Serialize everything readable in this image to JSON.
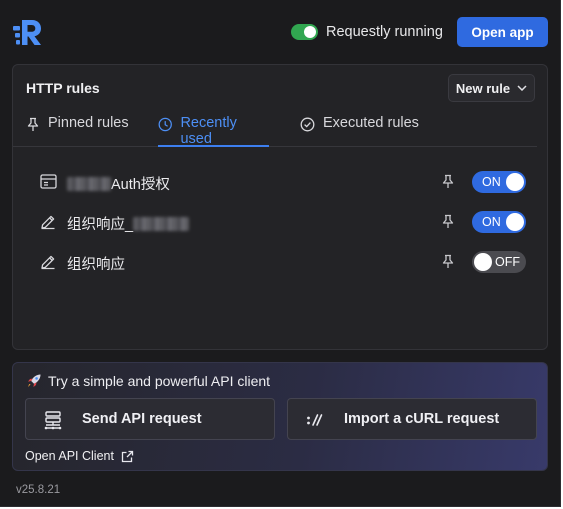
{
  "header": {
    "status_label": "Requestly running",
    "status_on": true,
    "open_app_label": "Open app",
    "accent_color": "#2f6ae0"
  },
  "rules_panel": {
    "title": "HTTP rules",
    "new_rule_label": "New rule",
    "tabs": [
      {
        "label": "Pinned rules",
        "icon": "pin-icon",
        "active": false
      },
      {
        "label": "Recently used",
        "icon": "clock-icon",
        "active": true
      },
      {
        "label": "Executed rules",
        "icon": "check-circle-icon",
        "active": false
      }
    ],
    "rules": [
      {
        "name": "Auth授权",
        "icon": "browser-window-icon",
        "state": "ON"
      },
      {
        "name": "组织响应_",
        "icon": "pencil-icon",
        "state": "ON"
      },
      {
        "name": "组织响应",
        "icon": "pencil-icon",
        "state": "OFF"
      }
    ]
  },
  "api_client": {
    "title": "Try a simple and powerful API client",
    "send_label": "Send API request",
    "import_label": "Import a cURL request",
    "open_client_label": "Open API Client"
  },
  "footer": {
    "version": "v25.8.21"
  }
}
